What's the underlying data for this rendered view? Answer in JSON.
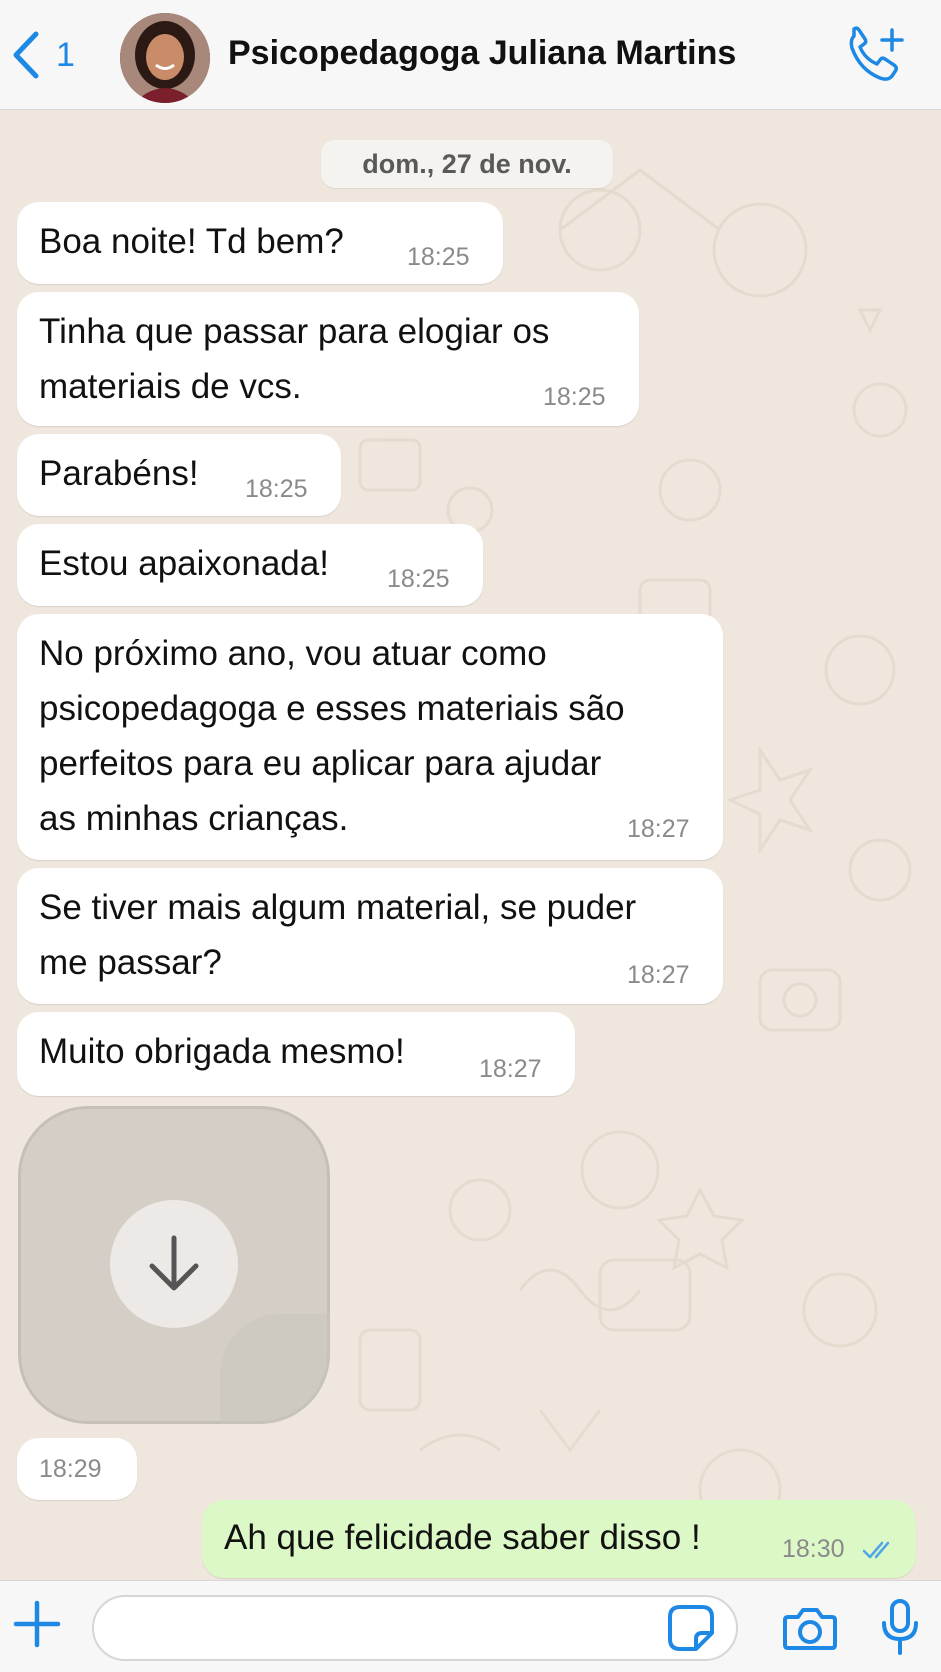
{
  "header": {
    "unread_count": "1",
    "contact_name": "Psicopedagoga Juliana Martins"
  },
  "chat": {
    "date_label": "dom., 27 de nov.",
    "incoming": [
      {
        "lines": [
          "Boa noite! Td bem?"
        ],
        "time": "18:25"
      },
      {
        "lines": [
          "Tinha que passar para elogiar os",
          "materiais de vcs."
        ],
        "time": "18:25"
      },
      {
        "lines": [
          "Parabéns!"
        ],
        "time": "18:25"
      },
      {
        "lines": [
          "Estou apaixonada!"
        ],
        "time": "18:25"
      },
      {
        "lines": [
          "No próximo ano, vou atuar como",
          "psicopedagoga e esses materiais são",
          "perfeitos para eu aplicar para ajudar",
          "as minhas crianças."
        ],
        "time": "18:27"
      },
      {
        "lines": [
          "Se tiver mais algum material, se puder",
          "me passar?"
        ],
        "time": "18:27"
      },
      {
        "lines": [
          "Muito obrigada mesmo!"
        ],
        "time": "18:27"
      }
    ],
    "sticker_time": "18:29",
    "outgoing": {
      "text": "Ah que felicidade saber disso !",
      "time": "18:30",
      "status": "read"
    }
  },
  "composer": {
    "placeholder": ""
  },
  "colors": {
    "accent": "#1e88e5",
    "outgoing_bubble": "#dcf8c6",
    "incoming_bubble": "#ffffff",
    "chat_background": "#efe7de"
  },
  "icons": [
    "chevron-left-icon",
    "add-call-icon",
    "plus-icon",
    "sticker-icon",
    "camera-icon",
    "microphone-icon",
    "download-arrow-icon",
    "double-check-icon"
  ]
}
